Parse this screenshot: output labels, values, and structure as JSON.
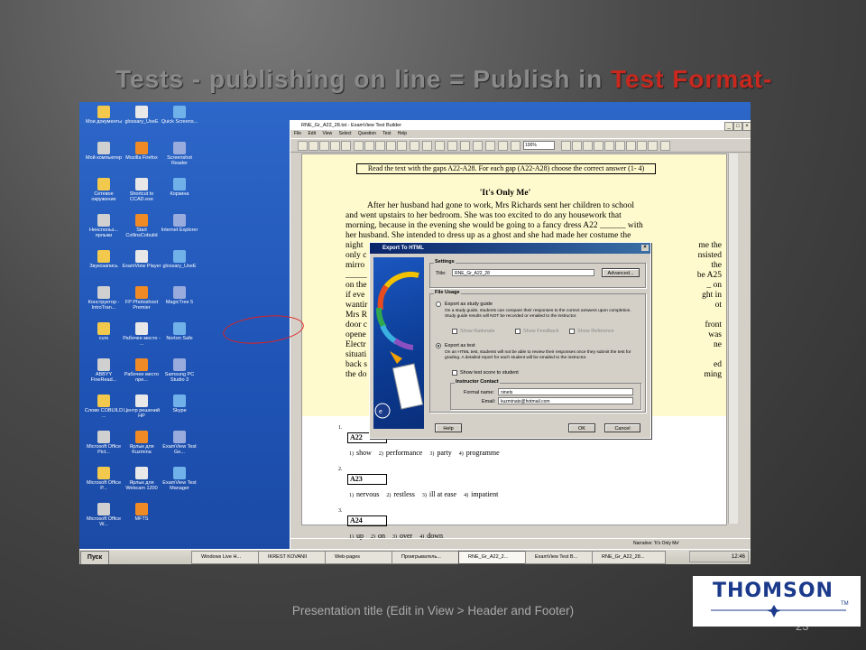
{
  "slide": {
    "title_main": "Tests - publishing on line = Publish in ",
    "title_accent": "Test Format-",
    "footer": "Presentation title (Edit in View > Header and Footer)",
    "page_number": "23",
    "logo_text": "THOMSON",
    "logo_tm": "TM",
    "accent_color": "#c8281e"
  },
  "desktop_icons": [
    {
      "label": "Мои документы"
    },
    {
      "label": "glossary_UseE"
    },
    {
      "label": "Quick Screens..."
    },
    {
      "label": "Мой компьютер"
    },
    {
      "label": "Mozilla Firefox"
    },
    {
      "label": "Screenshot Reader"
    },
    {
      "label": "Сетевое окружение"
    },
    {
      "label": "Shortcut to CCAD.exe"
    },
    {
      "label": "Корзина"
    },
    {
      "label": "Ненспольз... ярлыки"
    },
    {
      "label": "Start CollinsCobuild"
    },
    {
      "label": "Internet Explorer"
    },
    {
      "label": "Звукозапись"
    },
    {
      "label": "ExamView Player"
    },
    {
      "label": "glossary_UseE"
    },
    {
      "label": "Конструктор - IntroTran..."
    },
    {
      "label": "FP Photoshoot Premier"
    },
    {
      "label": "MagicTree 5"
    },
    {
      "label": "curs"
    },
    {
      "label": "Рабочее место - ..."
    },
    {
      "label": "Norton Safe"
    },
    {
      "label": "ABBYY FineRead..."
    },
    {
      "label": "Рабочее место пре..."
    },
    {
      "label": "Samsung PC Studio 3"
    },
    {
      "label": "Слово COBUILD ..."
    },
    {
      "label": "Центр решений HP"
    },
    {
      "label": "Skype"
    },
    {
      "label": "Microsoft Office Pict..."
    },
    {
      "label": "Ярлык для Kuzmina"
    },
    {
      "label": "ExamView Test Ge..."
    },
    {
      "label": "Microsoft Office P..."
    },
    {
      "label": "Ярлык для Webcam 1200"
    },
    {
      "label": "ExamView Test Manager"
    },
    {
      "label": "Microsoft Office W..."
    },
    {
      "label": "MFTS"
    }
  ],
  "app": {
    "title": "RNE_Gr_A22_28.tst - ExamView Test Builder",
    "menu": [
      "File",
      "Edit",
      "View",
      "Select",
      "Question",
      "Test",
      "Help"
    ],
    "zoom": "100%",
    "instructions": "Read the text with the gaps A22-A28. For each gap (A22-A28) choose the correct answer (1- 4)",
    "passage_title": "'It's Only Me'",
    "passage_lines": [
      "After her husband had gone to work, Mrs Richards sent her children to school",
      "and went upstairs to her bedroom. She was too excited to do any housework that",
      "morning, because in the evening she would be going to a fancy dress A22 ______ with",
      "her husband. She intended to dress up as a ghost and she had made her costume the"
    ],
    "passage_fragments_left": [
      "night",
      "only c",
      "mirro",
      "_____",
      "on the fr",
      "if eve",
      "wantir",
      "Mrs R",
      "door c",
      "opene",
      "Electr",
      "situati",
      "back s",
      "the do"
    ],
    "passage_fragments_right": [
      "me the",
      "nsisted",
      "the",
      "be A25",
      "_ on",
      "ght in",
      "ot",
      "",
      "front",
      "was",
      "ne",
      "",
      "ed",
      "ming"
    ],
    "questions": [
      {
        "num": "1.",
        "id": "A22",
        "options": [
          {
            "n": "1)",
            "t": "show"
          },
          {
            "n": "2)",
            "t": "performance"
          },
          {
            "n": "3)",
            "t": "party"
          },
          {
            "n": "4)",
            "t": "programme"
          }
        ]
      },
      {
        "num": "2.",
        "id": "A23",
        "options": [
          {
            "n": "1)",
            "t": "nervous"
          },
          {
            "n": "2)",
            "t": "restless"
          },
          {
            "n": "3)",
            "t": "ill at ease"
          },
          {
            "n": "4)",
            "t": "impatient"
          }
        ]
      },
      {
        "num": "3.",
        "id": "A24",
        "options": [
          {
            "n": "1)",
            "t": "up"
          },
          {
            "n": "2)",
            "t": "on"
          },
          {
            "n": "3)",
            "t": "over"
          },
          {
            "n": "4)",
            "t": "down"
          }
        ]
      }
    ],
    "status": "Narrative: 'It's Only Me'"
  },
  "dialog": {
    "title": "Export To HTML",
    "settings_label": "Settings",
    "title_label": "Title:",
    "title_value": "RNE_Gr_A22_28",
    "advanced_button": "Advanced...",
    "file_usage_label": "File Usage",
    "study_guide_option": "Export as study guide",
    "study_guide_desc": "On a study guide, students can compare their responses to the correct answers upon completion. Study guide results will NOT be recorded or emailed to the instructor.",
    "check_rationale": "Show Rationale",
    "check_feedback": "Show Feedback",
    "check_reference": "Show Reference",
    "test_option": "Export as test",
    "test_desc": "On an HTML test, students will not be able to review their responses once they submit the test for grading. A detailed report for each student will be emailed to the instructor.",
    "show_score": "Show test score to student",
    "instructor_label": "Instructor Contact",
    "formal_name_label": "Formal name:",
    "formal_name_value": "ninets",
    "email_label": "Email:",
    "email_value": "kuzminats@hotmail.com",
    "help_button": "Help",
    "ok_button": "OK",
    "cancel_button": "Cancel",
    "side_brand": "ExamView"
  },
  "taskbar": {
    "start": "Пуск",
    "tasks": [
      {
        "label": "Windows Live H..."
      },
      {
        "label": "IKREST KOVANII"
      },
      {
        "label": "Web-pages"
      },
      {
        "label": "Проигрыватель..."
      },
      {
        "label": "RNE_Gr_A22_2..."
      },
      {
        "label": "ExamView Test B..."
      },
      {
        "label": "RNE_Gr_A22_28..."
      }
    ],
    "clock": "12:46"
  }
}
